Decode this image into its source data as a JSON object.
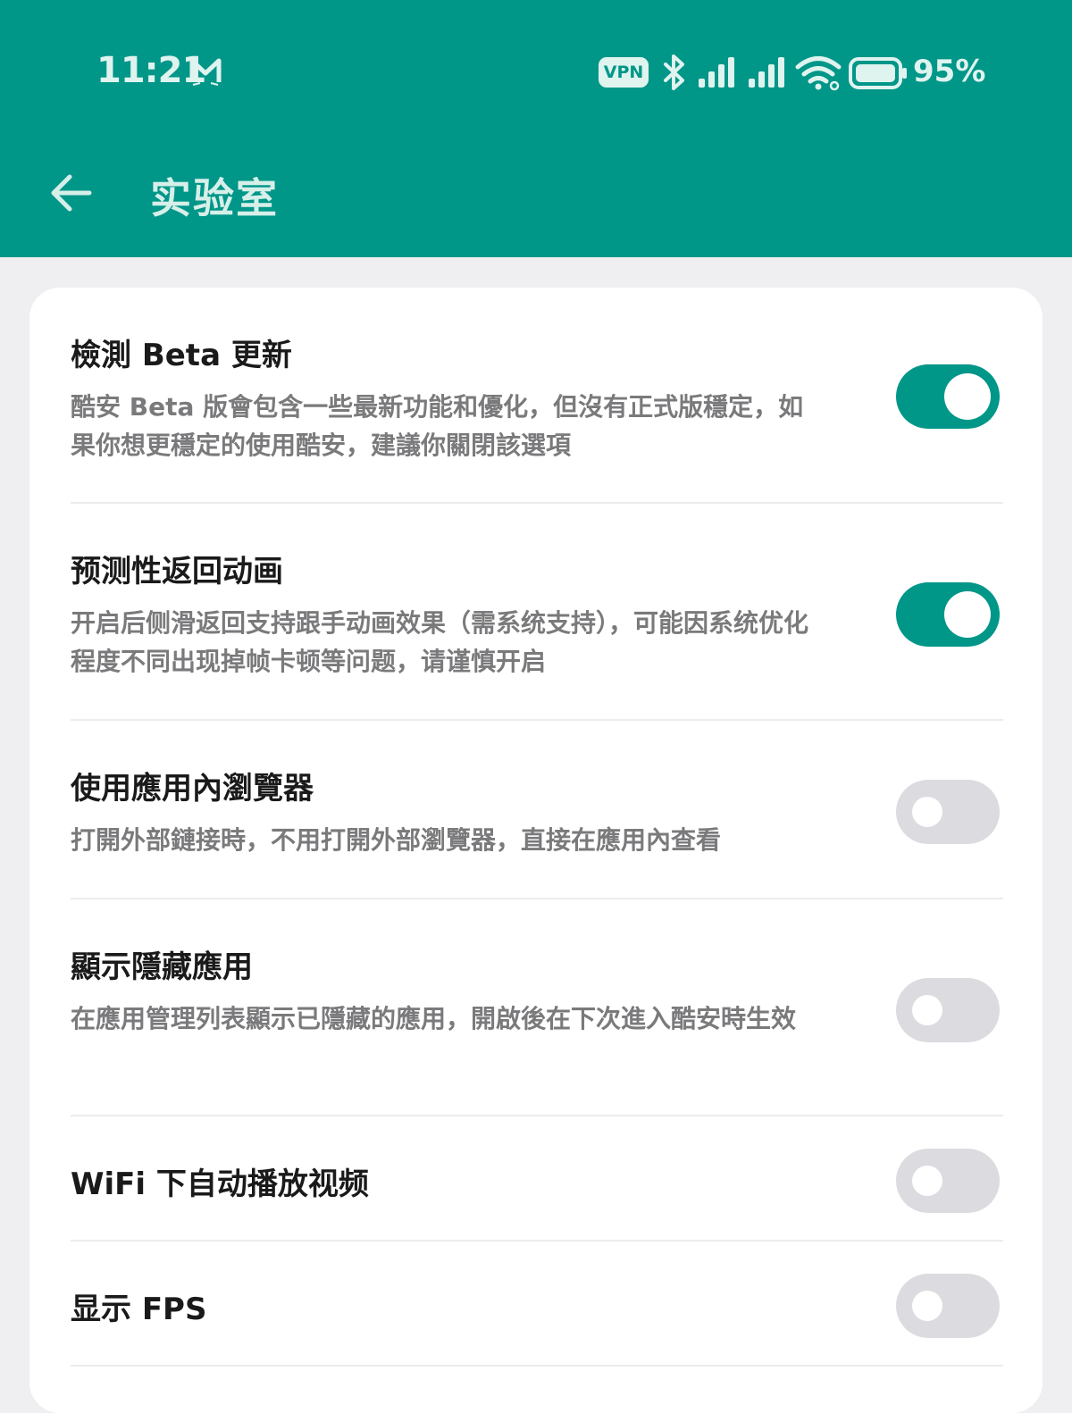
{
  "status_bar": {
    "time": "11:21",
    "vpn": "VPN",
    "battery": "95%",
    "icons": [
      "mail-icon",
      "vpn-icon",
      "bluetooth-icon",
      "signal-icon",
      "signal-icon",
      "wifi-icon",
      "battery-icon"
    ]
  },
  "app_bar": {
    "title": "实验室",
    "back_icon": "arrow-left-icon"
  },
  "colors": {
    "primary": "#009688",
    "toggle_off": "#dcdce0",
    "card": "#ffffff",
    "background": "#efeff2"
  },
  "settings": [
    {
      "title": "檢測 Beta 更新",
      "desc": "酷安 Beta 版會包含一些最新功能和優化，但沒有正式版穩定，如果你想更穩定的使用酷安，建議你關閉該選項",
      "enabled": true
    },
    {
      "title": "预测性返回动画",
      "desc": "开启后侧滑返回支持跟手动画效果（需系统支持），可能因系统优化程度不同出现掉帧卡顿等问题，请谨慎开启",
      "enabled": true
    },
    {
      "title": "使用應用內瀏覽器",
      "desc": "打開外部鏈接時，不用打開外部瀏覽器，直接在應用內查看",
      "enabled": false
    },
    {
      "title": "顯示隱藏應用",
      "desc": "在應用管理列表顯示已隱藏的應用，開啟後在下次進入酷安時生效",
      "enabled": false
    },
    {
      "title": "WiFi 下自动播放视频",
      "desc": "",
      "enabled": false
    },
    {
      "title": "显示 FPS",
      "desc": "",
      "enabled": false
    }
  ]
}
